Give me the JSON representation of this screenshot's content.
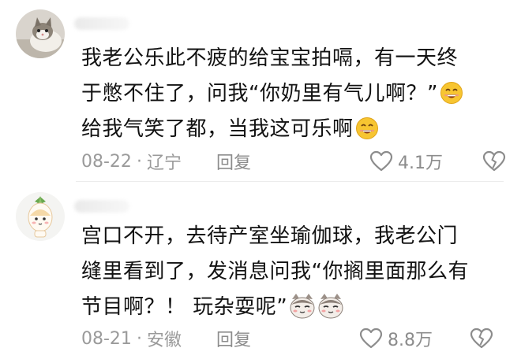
{
  "comments": [
    {
      "lines": [
        "我老公乐此不疲的给宝宝拍嗝，有一天终",
        "于憋不住了，问我“你奶里有气儿啊？”",
        "给我气笑了都，当我这可乐啊"
      ],
      "date": "08-22",
      "location": "辽宁",
      "reply_label": "回复",
      "likes": "4.1万",
      "avatar_icon": "cat-photo-avatar",
      "emoji": "grin-emoji"
    },
    {
      "lines": [
        "宫口不开，去待产室坐瑜伽球，我老公门",
        "缝里看到了，发消息问我“你搁里面那么有",
        "节目啊？！ 玩杂耍呢”"
      ],
      "date": "08-21",
      "location": "安徽",
      "reply_label": "回复",
      "likes": "8.8万",
      "avatar_icon": "cartoon-avatar",
      "emoji": "cat-face-emoji"
    }
  ],
  "separator": "·",
  "colors": {
    "text": "#121212",
    "meta": "#9a9a9a",
    "emoji_yellow": "#f7c531"
  }
}
